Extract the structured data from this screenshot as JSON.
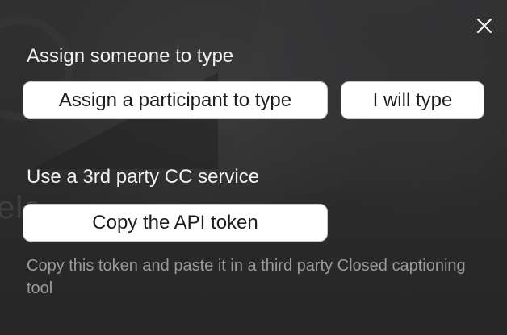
{
  "close": {
    "icon": "close-icon"
  },
  "assign_section": {
    "title": "Assign someone to type",
    "assign_participant_label": "Assign a participant to type",
    "self_type_label": "I will type"
  },
  "third_party_section": {
    "title": "Use a 3rd party CC service",
    "copy_token_label": "Copy the API token",
    "description": "Copy this token and paste it in a third party Closed captioning tool"
  },
  "colors": {
    "background": "#2c2c2d",
    "heading_text": "#f2f2f2",
    "button_bg": "#ffffff",
    "button_text": "#1c1c1e",
    "description_text": "#9a9a9d"
  }
}
